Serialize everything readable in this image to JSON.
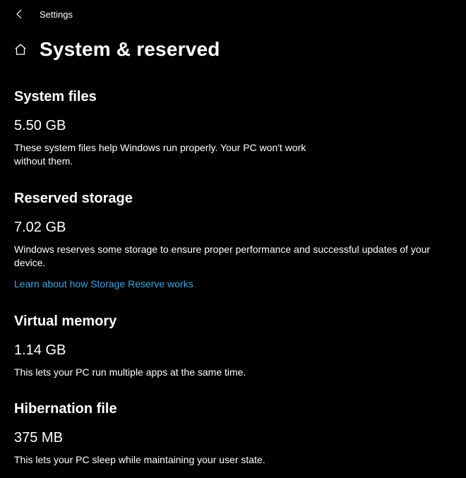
{
  "header": {
    "label": "Settings"
  },
  "page": {
    "title": "System & reserved"
  },
  "sections": {
    "system_files": {
      "heading": "System files",
      "size": "5.50 GB",
      "description": "These system files help Windows run properly. Your PC won't work without them."
    },
    "reserved_storage": {
      "heading": "Reserved storage",
      "size": "7.02 GB",
      "description": "Windows reserves some storage to ensure proper performance and successful updates of your device.",
      "link": "Learn about how Storage Reserve works"
    },
    "virtual_memory": {
      "heading": "Virtual memory",
      "size": "1.14 GB",
      "description": "This lets your PC run multiple apps at the same time."
    },
    "hibernation_file": {
      "heading": "Hibernation file",
      "size": "375 MB",
      "description": "This lets your PC sleep while maintaining your user state."
    }
  }
}
